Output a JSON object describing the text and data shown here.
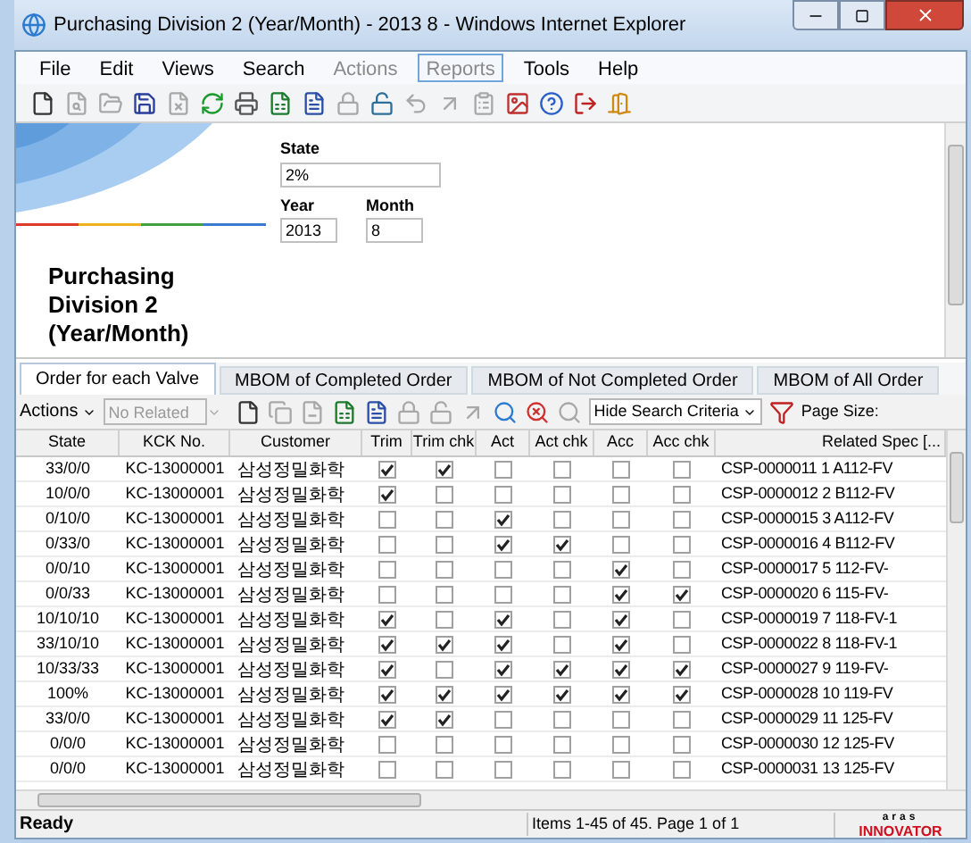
{
  "window": {
    "title": "Purchasing Division 2 (Year/Month) - 2013 8 - Windows Internet Explorer"
  },
  "menu": [
    {
      "label": "File",
      "disabled": false,
      "selected": false
    },
    {
      "label": "Edit",
      "disabled": false,
      "selected": false
    },
    {
      "label": "Views",
      "disabled": false,
      "selected": false
    },
    {
      "label": "Search",
      "disabled": false,
      "selected": false
    },
    {
      "label": "Actions",
      "disabled": true,
      "selected": false
    },
    {
      "label": "Reports",
      "disabled": true,
      "selected": true
    },
    {
      "label": "Tools",
      "disabled": false,
      "selected": false
    },
    {
      "label": "Help",
      "disabled": false,
      "selected": false
    }
  ],
  "header": {
    "title": "Purchasing Division 2 (Year/Month)",
    "fields": [
      {
        "label": "State",
        "value": "2%"
      },
      {
        "label": "Year",
        "value": "2013"
      },
      {
        "label": "Month",
        "value": "8"
      }
    ]
  },
  "tabs": [
    {
      "label": "Order for each Valve",
      "selected": true
    },
    {
      "label": "MBOM of Completed Order",
      "selected": false
    },
    {
      "label": "MBOM of Not Completed Order",
      "selected": false
    },
    {
      "label": "MBOM of All Order",
      "selected": false
    }
  ],
  "grid_toolbar": {
    "actions": "Actions",
    "related": {
      "placeholder": "No Related"
    },
    "search_mode": "Hide Search Criteria",
    "page_size": "Page Size:"
  },
  "table": {
    "columns": [
      "State",
      "KCK No.",
      "Customer",
      "Trim",
      "Trim chk",
      "Act",
      "Act chk",
      "Acc",
      "Acc chk",
      "Related Spec [..."
    ],
    "rows": [
      {
        "state": "33/0/0",
        "kck": "KC-13000001",
        "customer": "삼성정밀화학",
        "checks": [
          true,
          true,
          false,
          false,
          false,
          false
        ],
        "spec": "CSP-0000011 1 A112-FV"
      },
      {
        "state": "10/0/0",
        "kck": "KC-13000001",
        "customer": "삼성정밀화학",
        "checks": [
          true,
          false,
          false,
          false,
          false,
          false
        ],
        "spec": "CSP-0000012 2 B112-FV"
      },
      {
        "state": "0/10/0",
        "kck": "KC-13000001",
        "customer": "삼성정밀화학",
        "checks": [
          false,
          false,
          true,
          false,
          false,
          false
        ],
        "spec": "CSP-0000015 3 A112-FV"
      },
      {
        "state": "0/33/0",
        "kck": "KC-13000001",
        "customer": "삼성정밀화학",
        "checks": [
          false,
          false,
          true,
          true,
          false,
          false
        ],
        "spec": "CSP-0000016 4 B112-FV"
      },
      {
        "state": "0/0/10",
        "kck": "KC-13000001",
        "customer": "삼성정밀화학",
        "checks": [
          false,
          false,
          false,
          false,
          true,
          false
        ],
        "spec": "CSP-0000017 5 112-FV-"
      },
      {
        "state": "0/0/33",
        "kck": "KC-13000001",
        "customer": "삼성정밀화학",
        "checks": [
          false,
          false,
          false,
          false,
          true,
          true
        ],
        "spec": "CSP-0000020 6 115-FV-"
      },
      {
        "state": "10/10/10",
        "kck": "KC-13000001",
        "customer": "삼성정밀화학",
        "checks": [
          true,
          false,
          true,
          false,
          true,
          false
        ],
        "spec": "CSP-0000019 7 118-FV-1"
      },
      {
        "state": "33/10/10",
        "kck": "KC-13000001",
        "customer": "삼성정밀화학",
        "checks": [
          true,
          true,
          true,
          false,
          true,
          false
        ],
        "spec": "CSP-0000022 8 118-FV-1"
      },
      {
        "state": "10/33/33",
        "kck": "KC-13000001",
        "customer": "삼성정밀화학",
        "checks": [
          true,
          false,
          true,
          true,
          true,
          true
        ],
        "spec": "CSP-0000027 9 119-FV-"
      },
      {
        "state": "100%",
        "kck": "KC-13000001",
        "customer": "삼성정밀화학",
        "checks": [
          true,
          true,
          true,
          true,
          true,
          true
        ],
        "spec": "CSP-0000028 10 119-FV"
      },
      {
        "state": "33/0/0",
        "kck": "KC-13000001",
        "customer": "삼성정밀화학",
        "checks": [
          true,
          true,
          false,
          false,
          false,
          false
        ],
        "spec": "CSP-0000029 11 125-FV"
      },
      {
        "state": "0/0/0",
        "kck": "KC-13000001",
        "customer": "삼성정밀화학",
        "checks": [
          false,
          false,
          false,
          false,
          false,
          false
        ],
        "spec": "CSP-0000030 12 125-FV"
      },
      {
        "state": "0/0/0",
        "kck": "KC-13000001",
        "customer": "삼성정밀화학",
        "checks": [
          false,
          false,
          false,
          false,
          false,
          false
        ],
        "spec": "CSP-0000031 13 125-FV"
      }
    ]
  },
  "status_bar": {
    "state": "Ready",
    "items": "Items 1-45 of 45. Page 1 of 1",
    "logo_top": "aras",
    "logo_bottom": "INNOVATOR"
  }
}
